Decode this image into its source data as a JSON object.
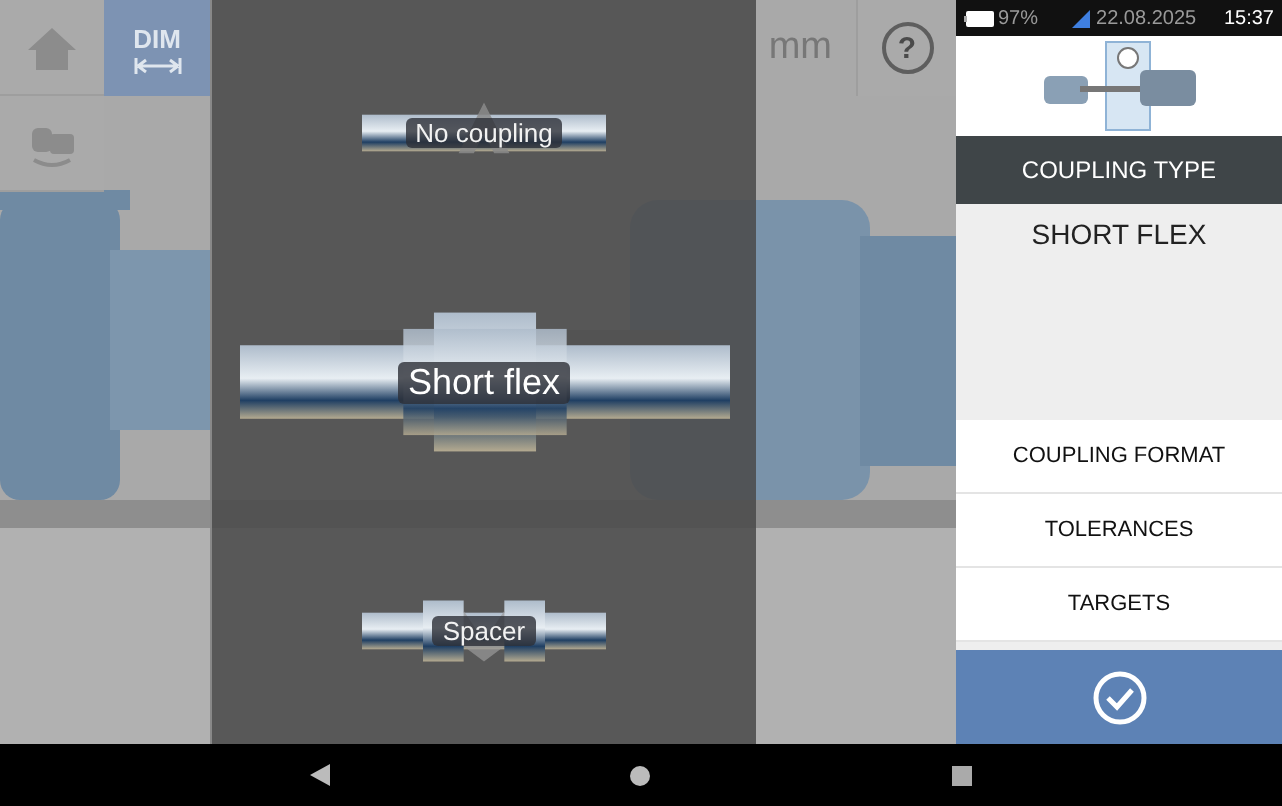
{
  "toolbar": {
    "dim_button": {
      "label": "DIM",
      "selected": true
    },
    "unit": "mm",
    "help": "?"
  },
  "coupling_picker": {
    "options": [
      {
        "label": "No coupling",
        "selected": false,
        "kind": "none"
      },
      {
        "label": "Short flex",
        "selected": true,
        "kind": "short_flex"
      },
      {
        "label": "Spacer",
        "selected": false,
        "kind": "spacer"
      }
    ]
  },
  "status_bar": {
    "battery": "97%",
    "date": "22.08.2025",
    "time": "15:37"
  },
  "panel": {
    "header": "COUPLING TYPE",
    "value": "SHORT FLEX",
    "menu": [
      "COUPLING FORMAT",
      "TOLERANCES",
      "TARGETS"
    ]
  }
}
